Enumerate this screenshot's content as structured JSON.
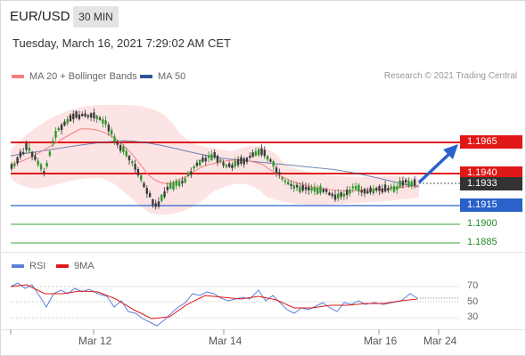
{
  "header": {
    "symbol": "EUR/USD",
    "timeframe": "30 MIN",
    "datetime": "Tuesday, March 16, 2021 7:29:02 AM CET"
  },
  "legend": {
    "items": [
      {
        "label": "MA 20 + Bollinger Bands",
        "color": "#f08080"
      },
      {
        "label": "MA 50",
        "color": "#2f5597"
      }
    ],
    "credit": "Research © 2021 Trading Central"
  },
  "price_levels": [
    {
      "value": "1.1965",
      "color": "#e01818",
      "style": "tag"
    },
    {
      "value": "1.1940",
      "color": "#e01818",
      "style": "tag"
    },
    {
      "value": "1.1933",
      "color": "#333333",
      "style": "tag"
    },
    {
      "value": "1.1915",
      "color": "#2a62c9",
      "style": "tag"
    },
    {
      "value": "1.1900",
      "color": "#238b23",
      "style": "plain"
    },
    {
      "value": "1.1885",
      "color": "#238b23",
      "style": "plain"
    }
  ],
  "rsi_legend": {
    "items": [
      {
        "label": "RSI",
        "color": "#5b7fd9"
      },
      {
        "label": "9MA",
        "color": "#e01818"
      }
    ]
  },
  "rsi_levels": [
    "70",
    "50",
    "30"
  ],
  "x_axis": [
    "Mar 12",
    "Mar 14",
    "Mar 16",
    "Mar 24"
  ]
}
